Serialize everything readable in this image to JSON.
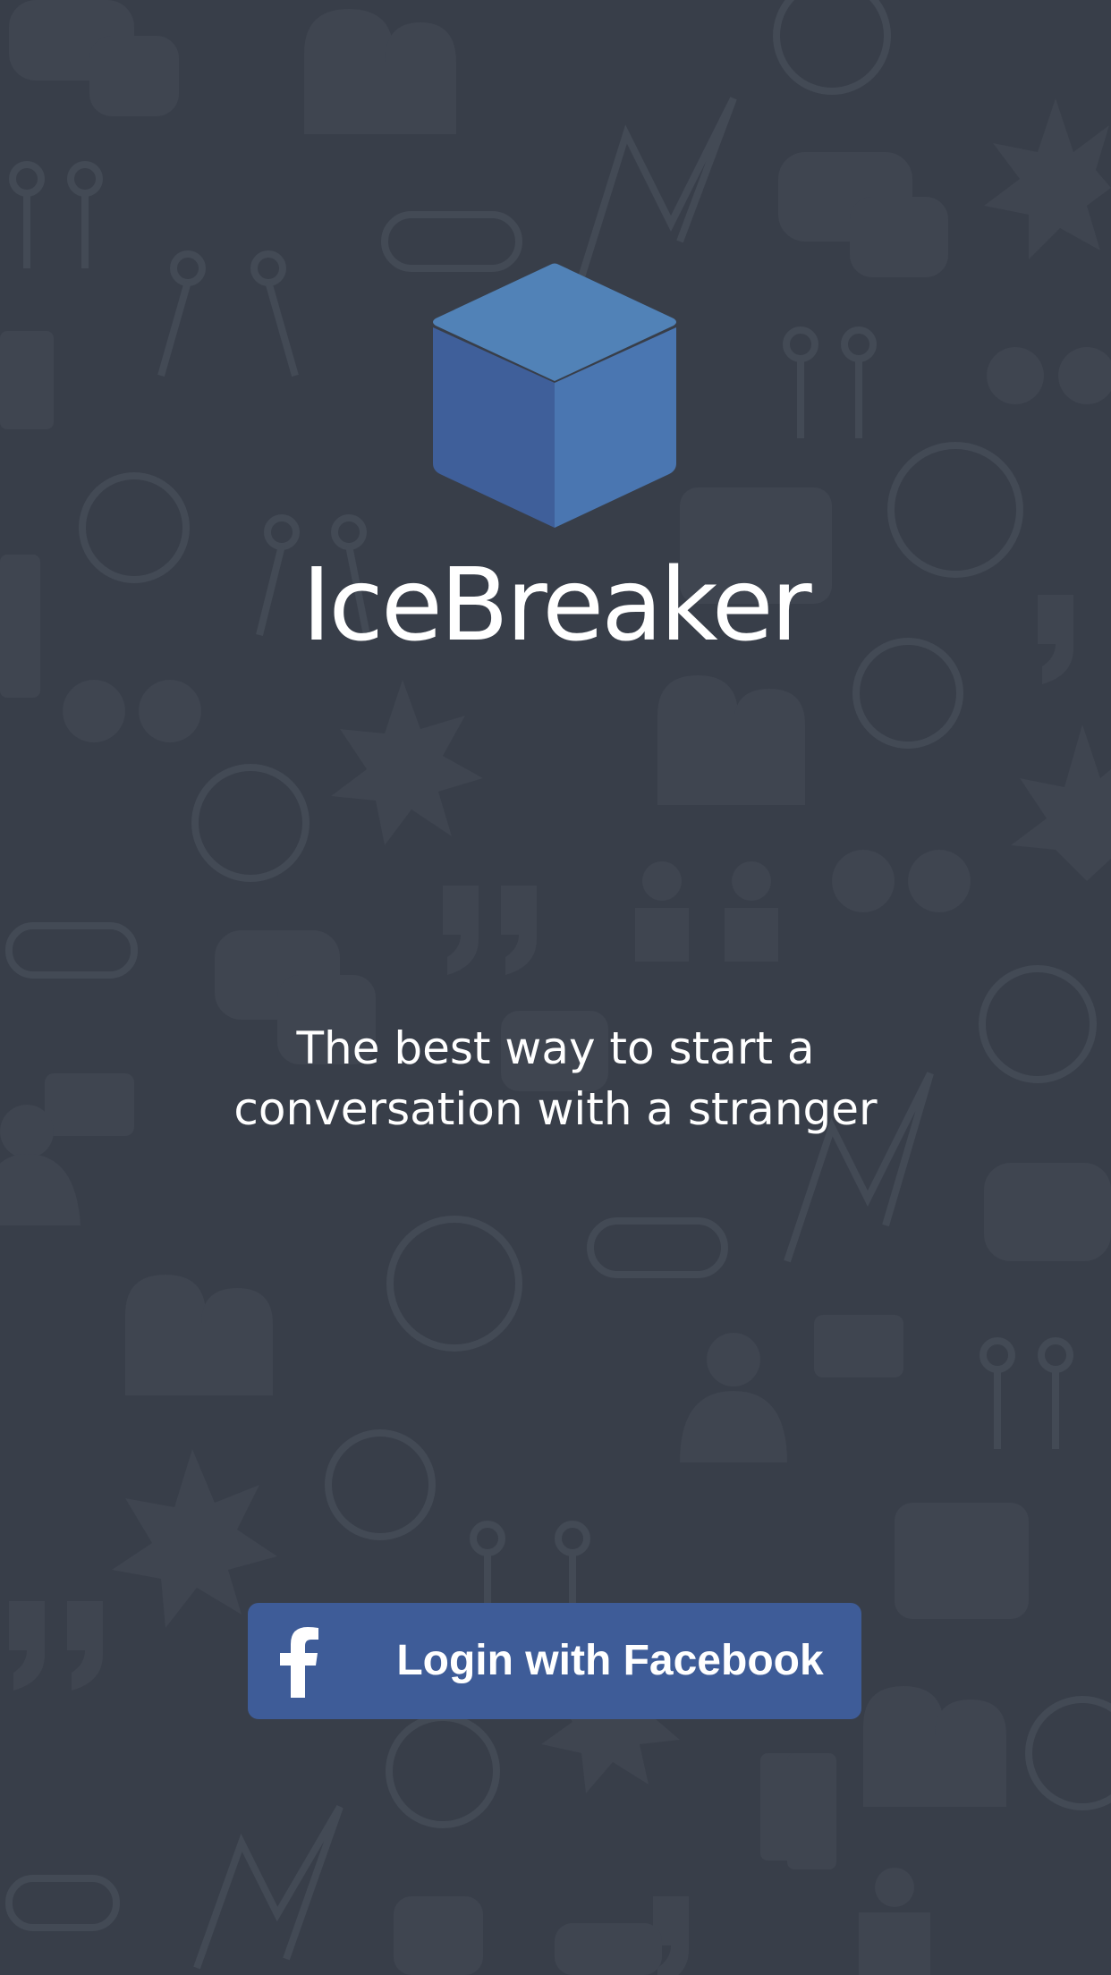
{
  "app": {
    "title": "IceBreaker",
    "tagline_line1": "The best way to start a",
    "tagline_line2": "conversation with a stranger"
  },
  "login": {
    "label": "Login with Facebook",
    "icon": "facebook-f-icon"
  },
  "colors": {
    "background": "#383e49",
    "cube_top": "#5182b7",
    "cube_left": "#3f5f9a",
    "cube_right": "#4a76b1",
    "facebook_blue": "#3e5c98"
  },
  "logo": {
    "icon": "cube-icon"
  }
}
